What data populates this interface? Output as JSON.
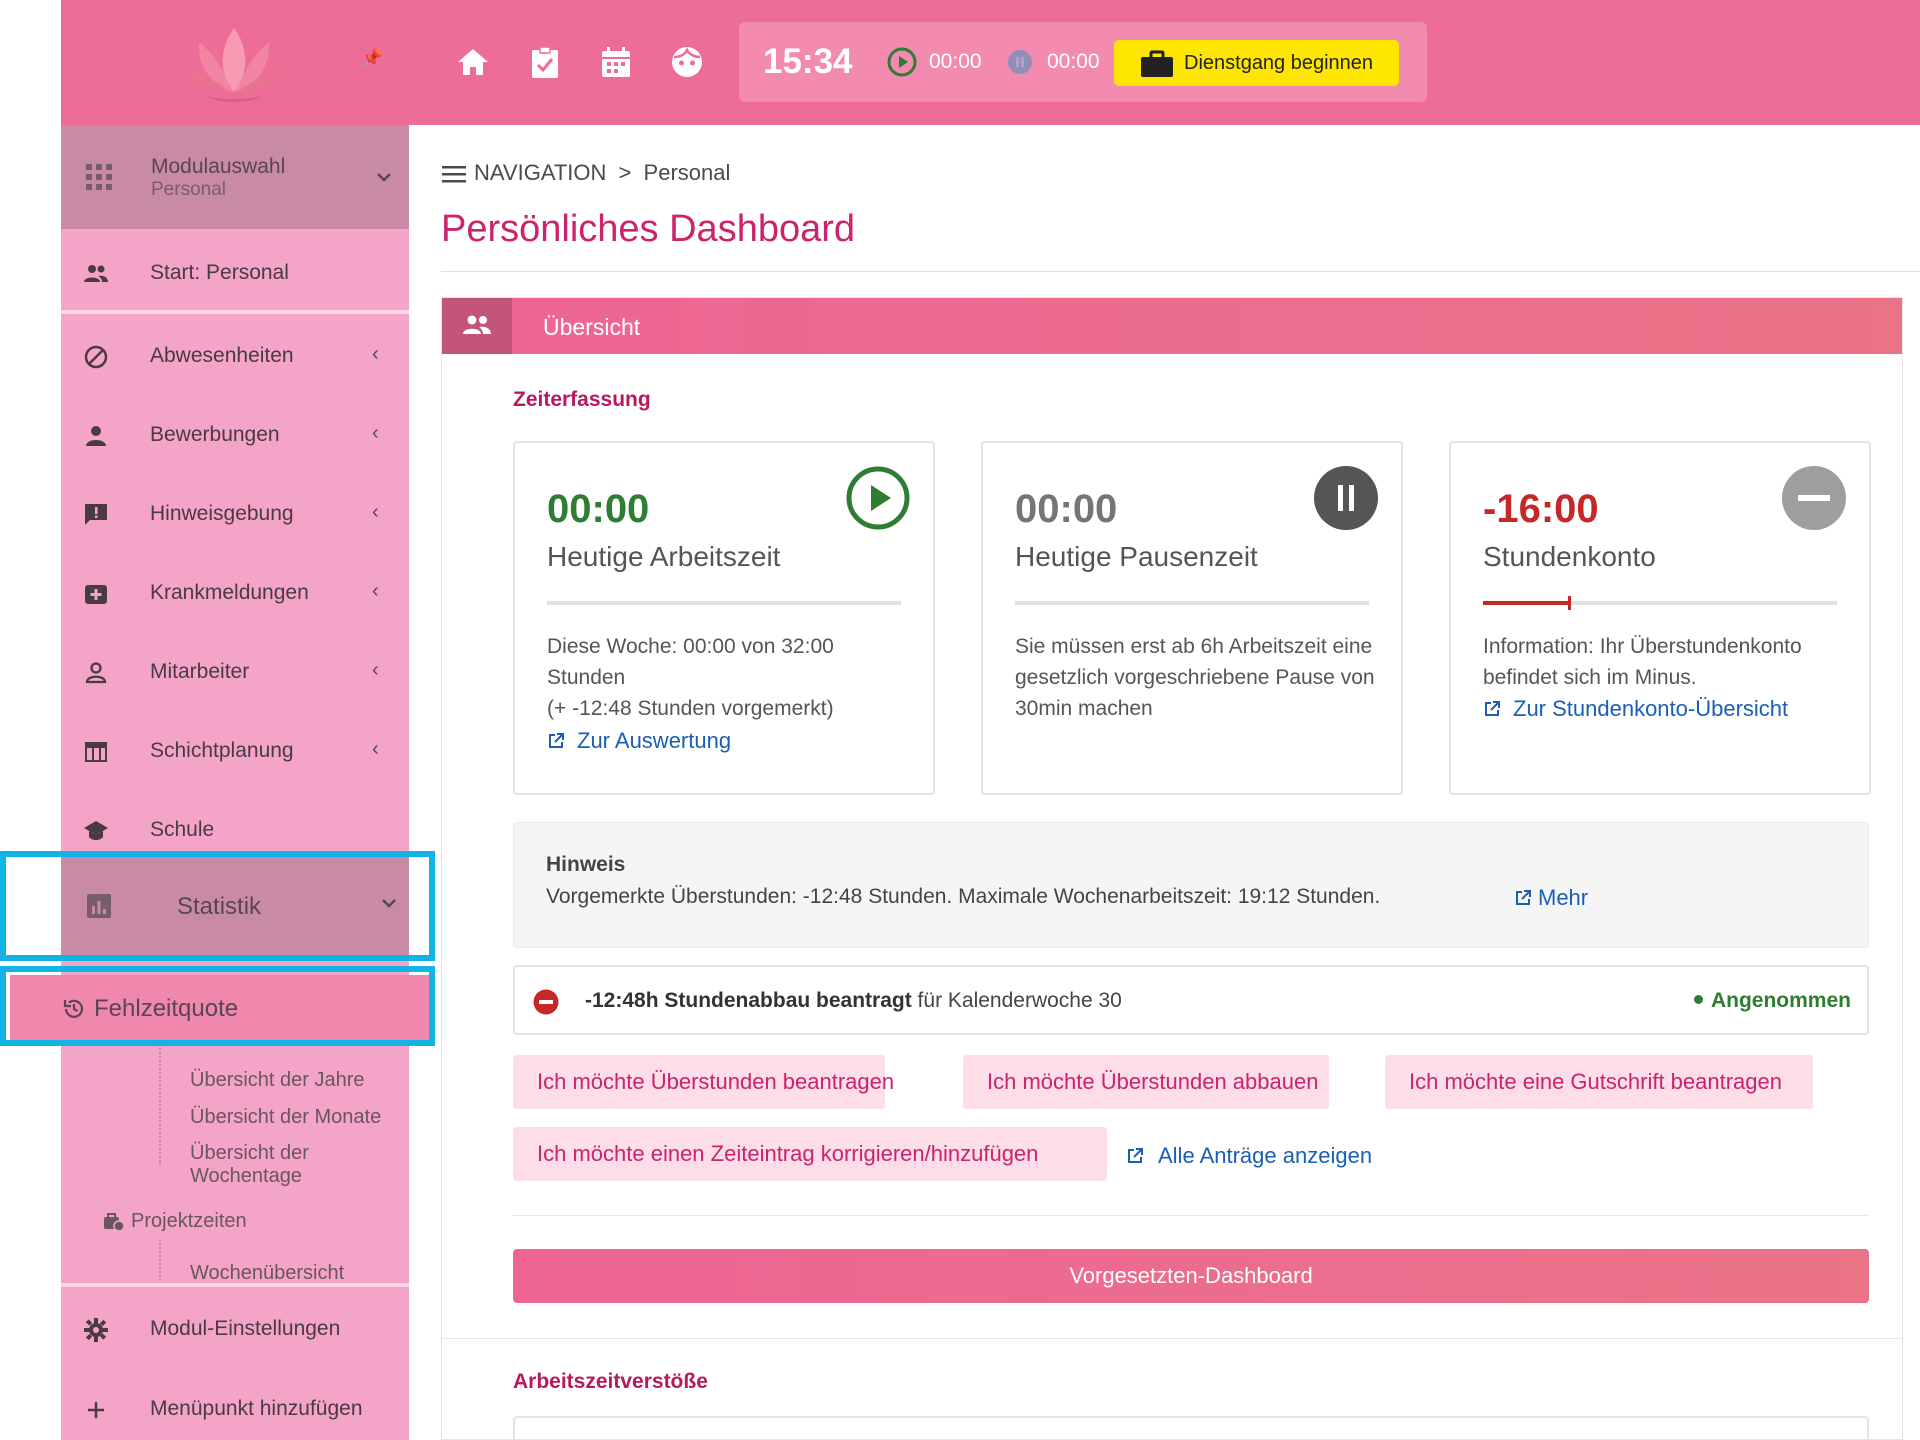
{
  "topbar": {
    "clock": "15:34",
    "work_time": "00:00",
    "pause_time": "00:00",
    "dienst_button": "Dienstgang beginnen",
    "icons": [
      "home-icon",
      "checklist-icon",
      "calendar-icon",
      "face-icon"
    ]
  },
  "sidebar": {
    "module_select": {
      "title": "Modulauswahl",
      "subtitle": "Personal"
    },
    "items": [
      {
        "label": "Start: Personal",
        "icon": "people-icon"
      },
      {
        "label": "Abwesenheiten",
        "icon": "block-icon",
        "arrow": "‹"
      },
      {
        "label": "Bewerbungen",
        "icon": "person-icon",
        "arrow": "‹"
      },
      {
        "label": "Hinweisgebung",
        "icon": "feedback-icon",
        "arrow": "‹"
      },
      {
        "label": "Krankmeldungen",
        "icon": "medical-icon",
        "arrow": "‹"
      },
      {
        "label": "Mitarbeiter",
        "icon": "person-outline-icon",
        "arrow": "‹"
      },
      {
        "label": "Schichtplanung",
        "icon": "table-icon",
        "arrow": "‹"
      },
      {
        "label": "Schule",
        "icon": "school-icon"
      }
    ],
    "statistik": {
      "label": "Statistik"
    },
    "fehlzeitquote": {
      "label": "Fehlzeitquote"
    },
    "sub_items": [
      "Übersicht der Jahre",
      "Übersicht der Monate",
      "Übersicht der Wochentage"
    ],
    "projektzeiten": "Projektzeiten",
    "wochenuebersicht": "Wochenübersicht",
    "modul_einstellungen": "Modul-Einstellungen",
    "menuepunkt": "Menüpunkt hinzufügen",
    "colors": {
      "sidebar": "#f4a4c6",
      "header": "#ee6d98",
      "highlight": "#12b3e6"
    }
  },
  "main": {
    "breadcrumb": {
      "nav": "NAVIGATION",
      "separator": ">",
      "current": "Personal"
    },
    "title": "Persönliches Dashboard",
    "panel_title": "Übersicht",
    "section_zeiterfassung": "Zeiterfassung",
    "cards": [
      {
        "value": "00:00",
        "caption": "Heutige Arbeitszeit",
        "text1": "Diese Woche: 00:00 von 32:00 Stunden",
        "text2": "(+ -12:48 Stunden vorgemerkt)",
        "link": "Zur Auswertung",
        "value_color": "#2e7d32"
      },
      {
        "value": "00:00",
        "caption": "Heutige Pausenzeit",
        "text1": "Sie müssen erst ab 6h Arbeitszeit eine gesetzlich vorgeschriebene Pause von 30min machen",
        "value_color": "#757575"
      },
      {
        "value": "-16:00",
        "caption": "Stundenkonto",
        "text1": "Information: Ihr Überstundenkonto befindet sich im Minus.",
        "link": "Zur Stundenkonto-Übersicht",
        "value_color": "#c62828"
      }
    ],
    "hint": {
      "title": "Hinweis",
      "text": "Vorgemerkte Überstunden: -12:48 Stunden. Maximale Wochenarbeitszeit: 19:12 Stunden.",
      "link": "Mehr"
    },
    "request": {
      "bold": "-12:48h Stundenabbau beantragt",
      "rest": " für Kalenderwoche 30",
      "status": "Angenommen"
    },
    "buttons": [
      "Ich möchte Überstunden beantragen",
      "Ich möchte Überstunden abbauen",
      "Ich möchte eine Gutschrift beantragen",
      "Ich möchte einen Zeiteintrag korrigieren/hinzufügen"
    ],
    "all_requests_link": "Alle Anträge anzeigen",
    "vorgesetzten_button": "Vorgesetzten-Dashboard",
    "section_verstoesse": "Arbeitszeitverstöße"
  }
}
